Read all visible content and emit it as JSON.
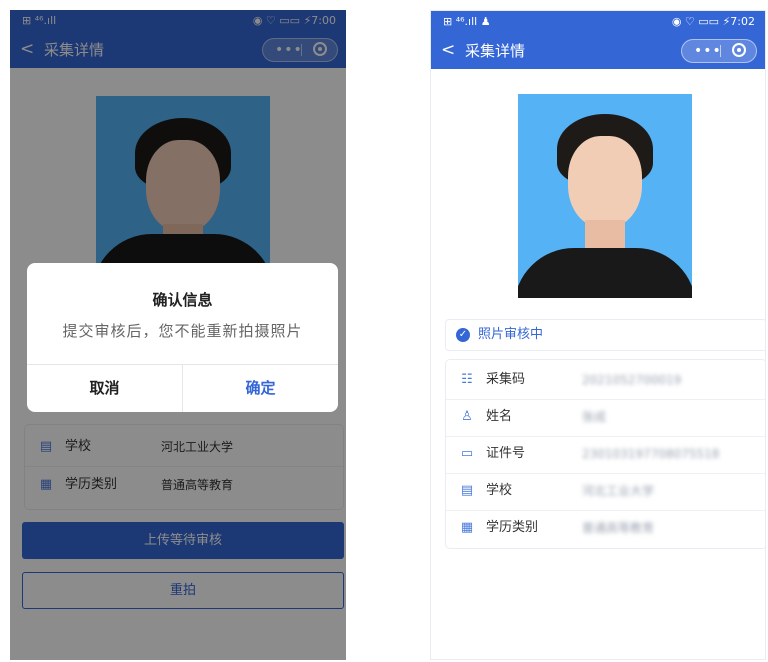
{
  "left": {
    "statusbar": {
      "left": "⊞ ⁴⁶.ıll",
      "right": "◉ ♡ ▭▭ ⚡7:00"
    },
    "nav": {
      "back": "<",
      "title": "采集详情",
      "more": "•••"
    },
    "rows": [
      {
        "icon": "school-icon",
        "glyph": "▤",
        "label": "学校",
        "value": "河北工业大学"
      },
      {
        "icon": "category-icon",
        "glyph": "▦",
        "label": "学历类别",
        "value": "普通高等教育"
      }
    ],
    "buttons": {
      "submit": "上传等待审核",
      "retake": "重拍"
    },
    "dialog": {
      "title": "确认信息",
      "message": "提交审核后，您不能重新拍摄照片",
      "cancel": "取消",
      "confirm": "确定"
    }
  },
  "right": {
    "statusbar": {
      "left": "⊞ ⁴⁶.ıll ♟",
      "right": "◉ ♡ ▭▭ ⚡7:02"
    },
    "nav": {
      "back": "<",
      "title": "采集详情",
      "more": "•••"
    },
    "status": {
      "text": "照片审核中",
      "check": "✓"
    },
    "rows": [
      {
        "icon": "barcode-icon",
        "glyph": "☷",
        "label": "采集码",
        "value": "2021052700019"
      },
      {
        "icon": "person-icon",
        "glyph": "♙",
        "label": "姓名",
        "value": "张成"
      },
      {
        "icon": "id-card-icon",
        "glyph": "▭",
        "label": "证件号",
        "value": "230103197708075518"
      },
      {
        "icon": "school-icon",
        "glyph": "▤",
        "label": "学校",
        "value": "河北工业大学"
      },
      {
        "icon": "category-icon",
        "glyph": "▦",
        "label": "学历类别",
        "value": "普通高等教育"
      }
    ]
  }
}
